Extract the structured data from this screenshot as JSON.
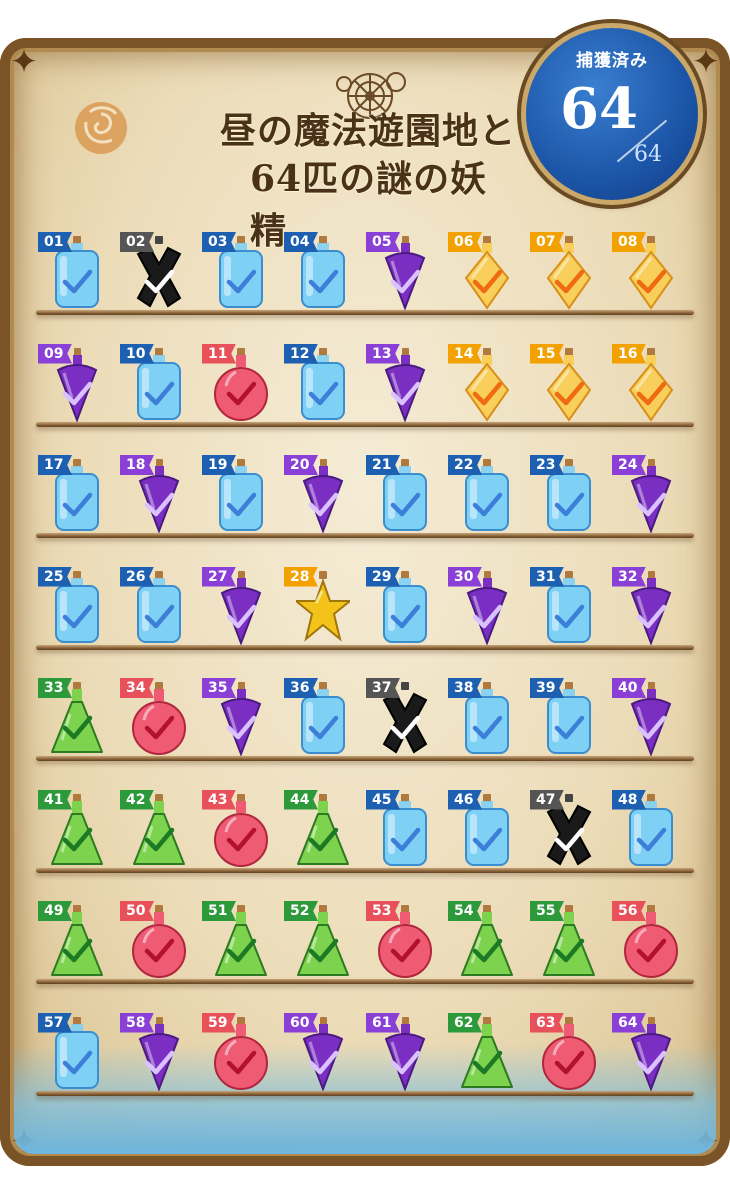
{
  "title": {
    "line1": "昼の魔法遊園地と",
    "line2": "64匹の謎の妖精"
  },
  "counter": {
    "label": "捕獲済み",
    "captured": "64",
    "total": "64"
  },
  "colors": {
    "blue": {
      "tag": "#1d5fb0",
      "fill": "#7fd0f5",
      "mark": "#3d7fd8"
    },
    "purple": {
      "tag": "#8a3fd6",
      "fill": "#7a2fc2",
      "mark": "#d9c2ff"
    },
    "orange": {
      "tag": "#f2a100",
      "fill": "#f7cf5a",
      "mark": "#f06a12"
    },
    "red": {
      "tag": "#e8505a",
      "fill": "#ef5b73",
      "mark": "#b3122e"
    },
    "green": {
      "tag": "#2c9a3a",
      "fill": "#7ed34e",
      "mark": "#1d7a24"
    },
    "black": {
      "tag": "#555555",
      "fill": "#1a1a1a",
      "mark": "#ffffff"
    },
    "gold": {
      "tag": "#f2a100",
      "fill": "#f3c21b",
      "mark": "#fff3a0"
    }
  },
  "icons": {
    "rose": "rose-emblem-icon",
    "gear": "clockwork-gear-icon",
    "check": "check-icon"
  },
  "fairies": [
    {
      "num": "01",
      "kind": "blue",
      "shape": "bottle"
    },
    {
      "num": "02",
      "kind": "black",
      "shape": "cross"
    },
    {
      "num": "03",
      "kind": "blue",
      "shape": "bottle"
    },
    {
      "num": "04",
      "kind": "blue",
      "shape": "bottle"
    },
    {
      "num": "05",
      "kind": "purple",
      "shape": "drop"
    },
    {
      "num": "06",
      "kind": "orange",
      "shape": "diamond"
    },
    {
      "num": "07",
      "kind": "orange",
      "shape": "diamond"
    },
    {
      "num": "08",
      "kind": "orange",
      "shape": "diamond"
    },
    {
      "num": "09",
      "kind": "purple",
      "shape": "drop"
    },
    {
      "num": "10",
      "kind": "blue",
      "shape": "bottle"
    },
    {
      "num": "11",
      "kind": "red",
      "shape": "round"
    },
    {
      "num": "12",
      "kind": "blue",
      "shape": "bottle"
    },
    {
      "num": "13",
      "kind": "purple",
      "shape": "drop"
    },
    {
      "num": "14",
      "kind": "orange",
      "shape": "diamond"
    },
    {
      "num": "15",
      "kind": "orange",
      "shape": "diamond"
    },
    {
      "num": "16",
      "kind": "orange",
      "shape": "diamond"
    },
    {
      "num": "17",
      "kind": "blue",
      "shape": "bottle"
    },
    {
      "num": "18",
      "kind": "purple",
      "shape": "drop"
    },
    {
      "num": "19",
      "kind": "blue",
      "shape": "bottle"
    },
    {
      "num": "20",
      "kind": "purple",
      "shape": "drop"
    },
    {
      "num": "21",
      "kind": "blue",
      "shape": "bottle"
    },
    {
      "num": "22",
      "kind": "blue",
      "shape": "bottle"
    },
    {
      "num": "23",
      "kind": "blue",
      "shape": "bottle"
    },
    {
      "num": "24",
      "kind": "purple",
      "shape": "drop"
    },
    {
      "num": "25",
      "kind": "blue",
      "shape": "bottle"
    },
    {
      "num": "26",
      "kind": "blue",
      "shape": "bottle"
    },
    {
      "num": "27",
      "kind": "purple",
      "shape": "drop"
    },
    {
      "num": "28",
      "kind": "gold",
      "shape": "star"
    },
    {
      "num": "29",
      "kind": "blue",
      "shape": "bottle"
    },
    {
      "num": "30",
      "kind": "purple",
      "shape": "drop"
    },
    {
      "num": "31",
      "kind": "blue",
      "shape": "bottle"
    },
    {
      "num": "32",
      "kind": "purple",
      "shape": "drop"
    },
    {
      "num": "33",
      "kind": "green",
      "shape": "flask"
    },
    {
      "num": "34",
      "kind": "red",
      "shape": "round"
    },
    {
      "num": "35",
      "kind": "purple",
      "shape": "drop"
    },
    {
      "num": "36",
      "kind": "blue",
      "shape": "bottle"
    },
    {
      "num": "37",
      "kind": "black",
      "shape": "cross"
    },
    {
      "num": "38",
      "kind": "blue",
      "shape": "bottle"
    },
    {
      "num": "39",
      "kind": "blue",
      "shape": "bottle"
    },
    {
      "num": "40",
      "kind": "purple",
      "shape": "drop"
    },
    {
      "num": "41",
      "kind": "green",
      "shape": "flask"
    },
    {
      "num": "42",
      "kind": "green",
      "shape": "flask"
    },
    {
      "num": "43",
      "kind": "red",
      "shape": "round"
    },
    {
      "num": "44",
      "kind": "green",
      "shape": "flask"
    },
    {
      "num": "45",
      "kind": "blue",
      "shape": "bottle"
    },
    {
      "num": "46",
      "kind": "blue",
      "shape": "bottle"
    },
    {
      "num": "47",
      "kind": "black",
      "shape": "cross"
    },
    {
      "num": "48",
      "kind": "blue",
      "shape": "bottle"
    },
    {
      "num": "49",
      "kind": "green",
      "shape": "flask"
    },
    {
      "num": "50",
      "kind": "red",
      "shape": "round"
    },
    {
      "num": "51",
      "kind": "green",
      "shape": "flask"
    },
    {
      "num": "52",
      "kind": "green",
      "shape": "flask"
    },
    {
      "num": "53",
      "kind": "red",
      "shape": "round"
    },
    {
      "num": "54",
      "kind": "green",
      "shape": "flask"
    },
    {
      "num": "55",
      "kind": "green",
      "shape": "flask"
    },
    {
      "num": "56",
      "kind": "red",
      "shape": "round"
    },
    {
      "num": "57",
      "kind": "blue",
      "shape": "bottle"
    },
    {
      "num": "58",
      "kind": "purple",
      "shape": "drop"
    },
    {
      "num": "59",
      "kind": "red",
      "shape": "round"
    },
    {
      "num": "60",
      "kind": "purple",
      "shape": "drop"
    },
    {
      "num": "61",
      "kind": "purple",
      "shape": "drop"
    },
    {
      "num": "62",
      "kind": "green",
      "shape": "flask"
    },
    {
      "num": "63",
      "kind": "red",
      "shape": "round"
    },
    {
      "num": "64",
      "kind": "purple",
      "shape": "drop"
    }
  ]
}
